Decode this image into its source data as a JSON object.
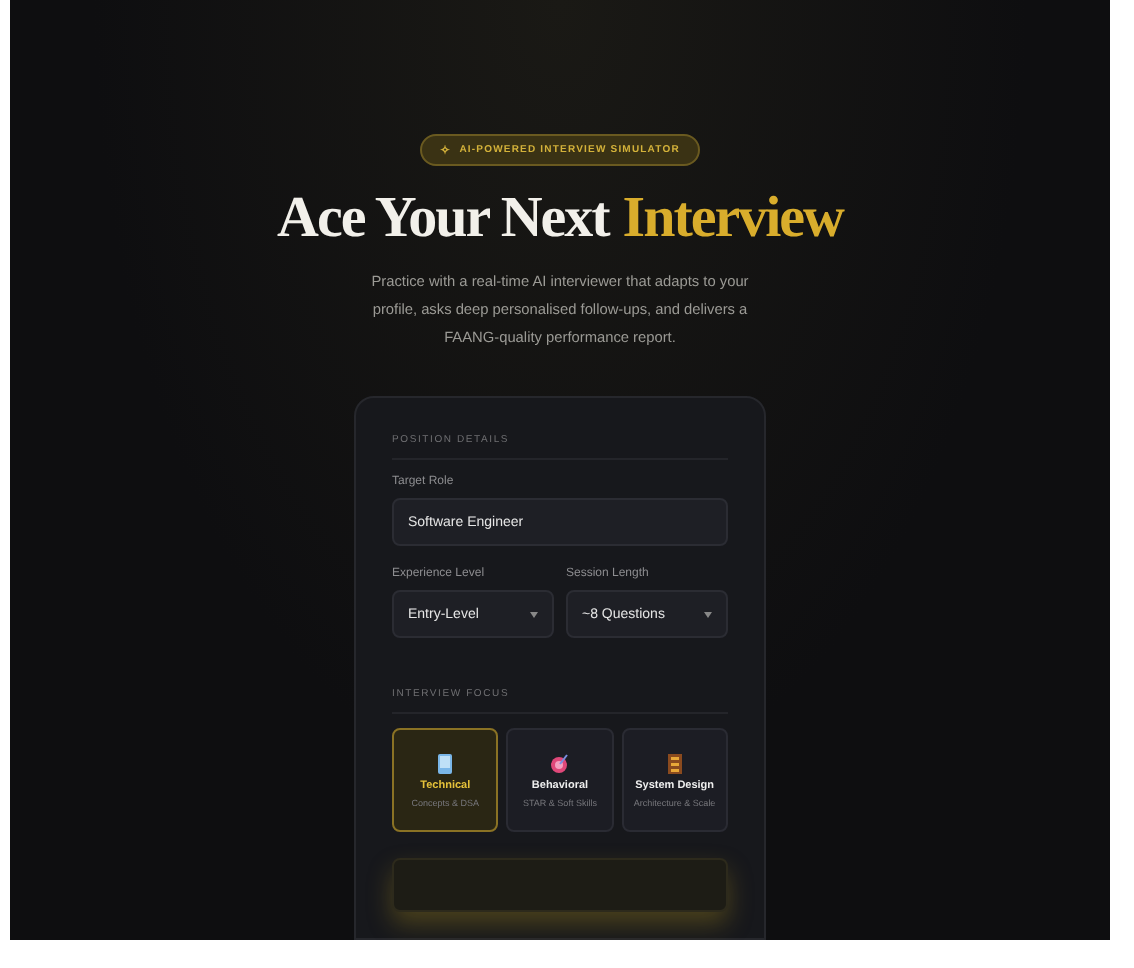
{
  "badge": {
    "icon": "✧",
    "text": "AI-POWERED INTERVIEW SIMULATOR"
  },
  "headline": {
    "lead": "Ace Your Next",
    "accent": "Interview"
  },
  "subtitle": "Practice with a real-time AI interviewer that adapts to your profile, asks deep personalised follow-ups, and delivers a FAANG-quality performance report.",
  "form": {
    "section_title": "POSITION DETAILS",
    "target_role": {
      "label": "Target Role",
      "value": "Software Engineer"
    },
    "experience": {
      "label": "Experience Level",
      "value": "Entry-Level"
    },
    "session": {
      "label": "Session Length",
      "value": "~8 Questions"
    },
    "focus_title": "INTERVIEW FOCUS",
    "focus_options": [
      {
        "kind": "technical",
        "title": "Technical",
        "subtitle": "Concepts & DSA",
        "selected": true
      },
      {
        "kind": "behavioral",
        "title": "Behavioral",
        "subtitle": "STAR & Soft Skills",
        "selected": false
      },
      {
        "kind": "design",
        "title": "System Design",
        "subtitle": "Architecture & Scale",
        "selected": false
      }
    ],
    "start_button": {
      "disabled": true
    }
  }
}
